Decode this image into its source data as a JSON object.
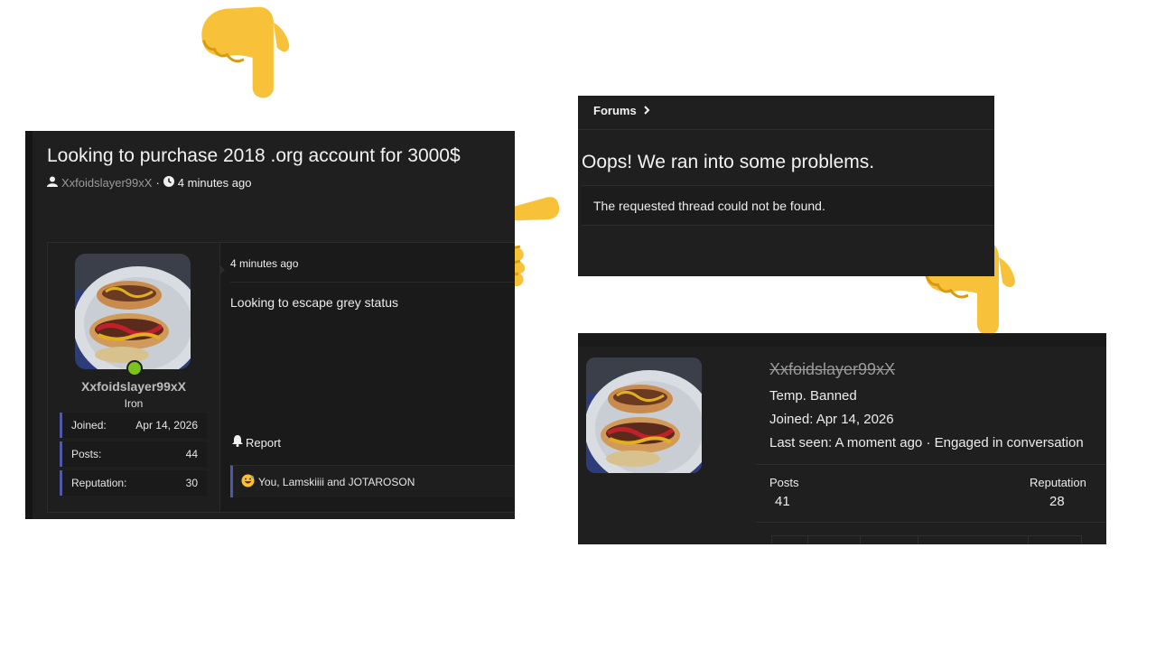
{
  "thread": {
    "title": "Looking to purchase 2018 .org account for 3000$",
    "author": "Xxfoidslayer99xX",
    "separator": "·",
    "time": "4 minutes ago",
    "post": {
      "username": "Xxfoidslayer99xX",
      "rank": "Iron",
      "stats": [
        {
          "label": "Joined:",
          "value": "Apr 14, 2026"
        },
        {
          "label": "Posts:",
          "value": "44"
        },
        {
          "label": "Reputation:",
          "value": "30"
        }
      ],
      "time": "4 minutes ago",
      "body": "Looking to escape grey status",
      "report_label": "Report",
      "reactions_text": "You, Lamskiiii and JOTAROSON"
    }
  },
  "forums": {
    "breadcrumb": "Forums",
    "heading": "Oops! We ran into some problems.",
    "message": "The requested thread could not be found."
  },
  "profile": {
    "username": "Xxfoidslayer99xX",
    "status": "Temp. Banned",
    "joined": "Joined: Apr 14, 2026",
    "last_seen": "Last seen: A moment ago · Engaged in conversation",
    "posts_label": "Posts",
    "posts_value": "41",
    "reputation_label": "Reputation",
    "reputation_value": "28"
  },
  "icons": {
    "user": "user-icon",
    "clock": "clock-icon",
    "bell": "bell-icon",
    "reaction": "grinning-sweat-emoji",
    "chevron": "chevron-right-icon",
    "pointer": "pointing-hand-emoji"
  },
  "colors": {
    "panel_bg": "#1f1f1f",
    "accent": "#4d5aa8",
    "online": "#7bc21a",
    "emoji": "#f7c23a"
  }
}
